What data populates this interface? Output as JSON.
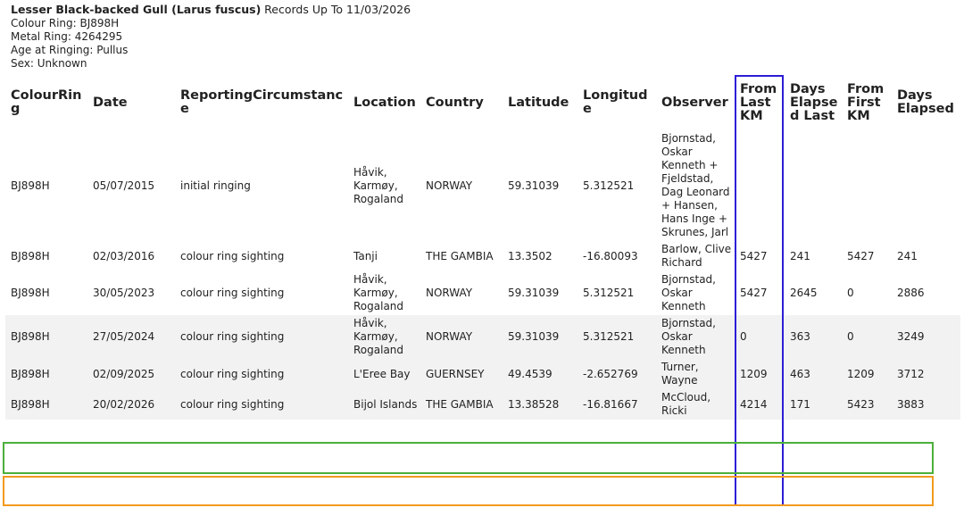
{
  "header": {
    "species": "Lesser Black-backed Gull (Larus fuscus)",
    "records_suffix": "Records Up To 11/03/2026",
    "colour_ring": "Colour Ring: BJ898H",
    "metal_ring": "Metal Ring: 4264295",
    "age_at_ringing": "Age at Ringing: Pullus",
    "sex": "Sex: Unknown"
  },
  "columns": [
    "ColourRing",
    "Date",
    "ReportingCircumstance",
    "Location",
    "Country",
    "Latitude",
    "Longitude",
    "Observer",
    "From Last KM",
    "Days Elapsed Last",
    "From First KM",
    "Days Elapsed"
  ],
  "rows": [
    [
      "BJ898H",
      "05/07/2015",
      "initial ringing",
      "Håvik, Karmøy, Rogaland",
      "NORWAY",
      "59.31039",
      "5.312521",
      "Bjornstad, Oskar Kenneth + Fjeldstad, Dag Leonard + Hansen, Hans Inge + Skrunes, Jarl",
      "",
      "",
      "",
      ""
    ],
    [
      "BJ898H",
      "02/03/2016",
      "colour ring sighting",
      "Tanji",
      "THE GAMBIA",
      "13.3502",
      "-16.80093",
      "Barlow, Clive Richard",
      "5427",
      "241",
      "5427",
      "241"
    ],
    [
      "BJ898H",
      "30/05/2023",
      "colour ring sighting",
      "Håvik, Karmøy, Rogaland",
      "NORWAY",
      "59.31039",
      "5.312521",
      "Bjornstad, Oskar Kenneth",
      "5427",
      "2645",
      "0",
      "2886"
    ],
    [
      "BJ898H",
      "27/05/2024",
      "colour ring sighting",
      "Håvik, Karmøy, Rogaland",
      "NORWAY",
      "59.31039",
      "5.312521",
      "Bjornstad, Oskar Kenneth",
      "0",
      "363",
      "0",
      "3249"
    ],
    [
      "BJ898H",
      "02/09/2025",
      "colour ring sighting",
      "L'Eree Bay",
      "GUERNSEY",
      "49.4539",
      "-2.652769",
      "Turner, Wayne",
      "1209",
      "463",
      "1209",
      "3712"
    ],
    [
      "BJ898H",
      "20/02/2026",
      "colour ring sighting",
      "Bijol Islands",
      "THE GAMBIA",
      "13.38528",
      "-16.81667",
      "McCloud, Ricki",
      "4214",
      "171",
      "5423",
      "3883"
    ]
  ],
  "highlight_colors": {
    "from_last_km_column": "#2c1dd6",
    "row_guernsey": "#4caf3a",
    "row_bijol": "#f29a1f",
    "row_alt_background": "#f2f2f2"
  }
}
